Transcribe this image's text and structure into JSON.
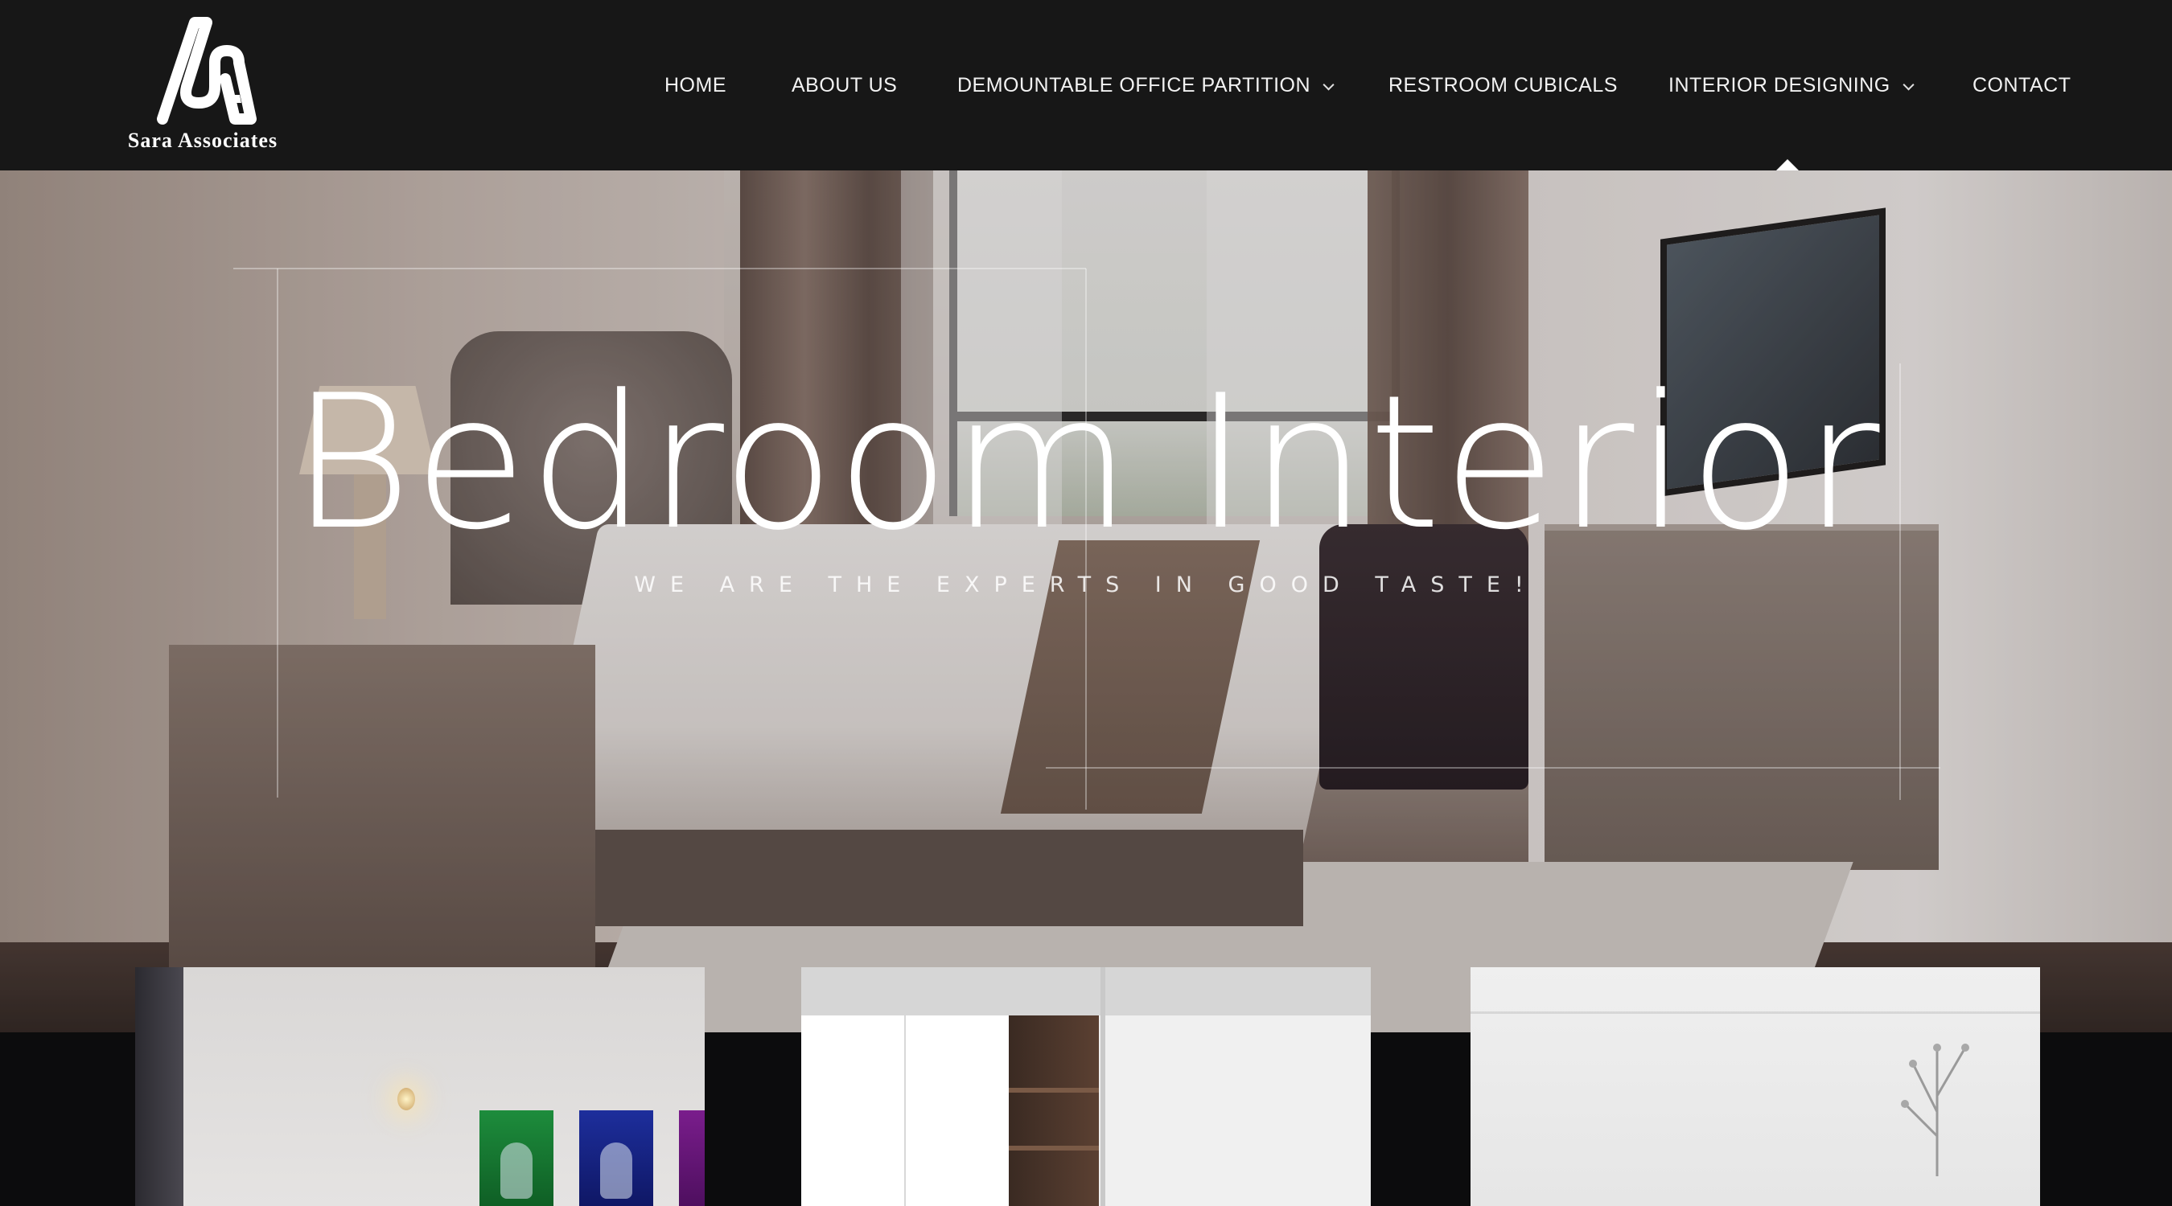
{
  "brand": {
    "name": "Sara Associates",
    "logo_icon": "sa-monogram-icon"
  },
  "nav": {
    "items": [
      {
        "label": "HOME",
        "has_dropdown": false
      },
      {
        "label": "ABOUT US",
        "has_dropdown": false
      },
      {
        "label": "DEMOUNTABLE OFFICE PARTITION",
        "has_dropdown": true
      },
      {
        "label": "RESTROOM CUBICALS",
        "has_dropdown": false
      },
      {
        "label": "INTERIOR DESIGNING",
        "has_dropdown": true,
        "active": true
      },
      {
        "label": "CONTACT",
        "has_dropdown": false
      }
    ]
  },
  "hero": {
    "title": "Bedroom Interior",
    "subtitle": "WE ARE THE EXPERTS IN GOOD TASTE!"
  },
  "colors": {
    "header_bg": "#171717",
    "page_bg": "#0c0c0d",
    "text": "#ffffff"
  }
}
